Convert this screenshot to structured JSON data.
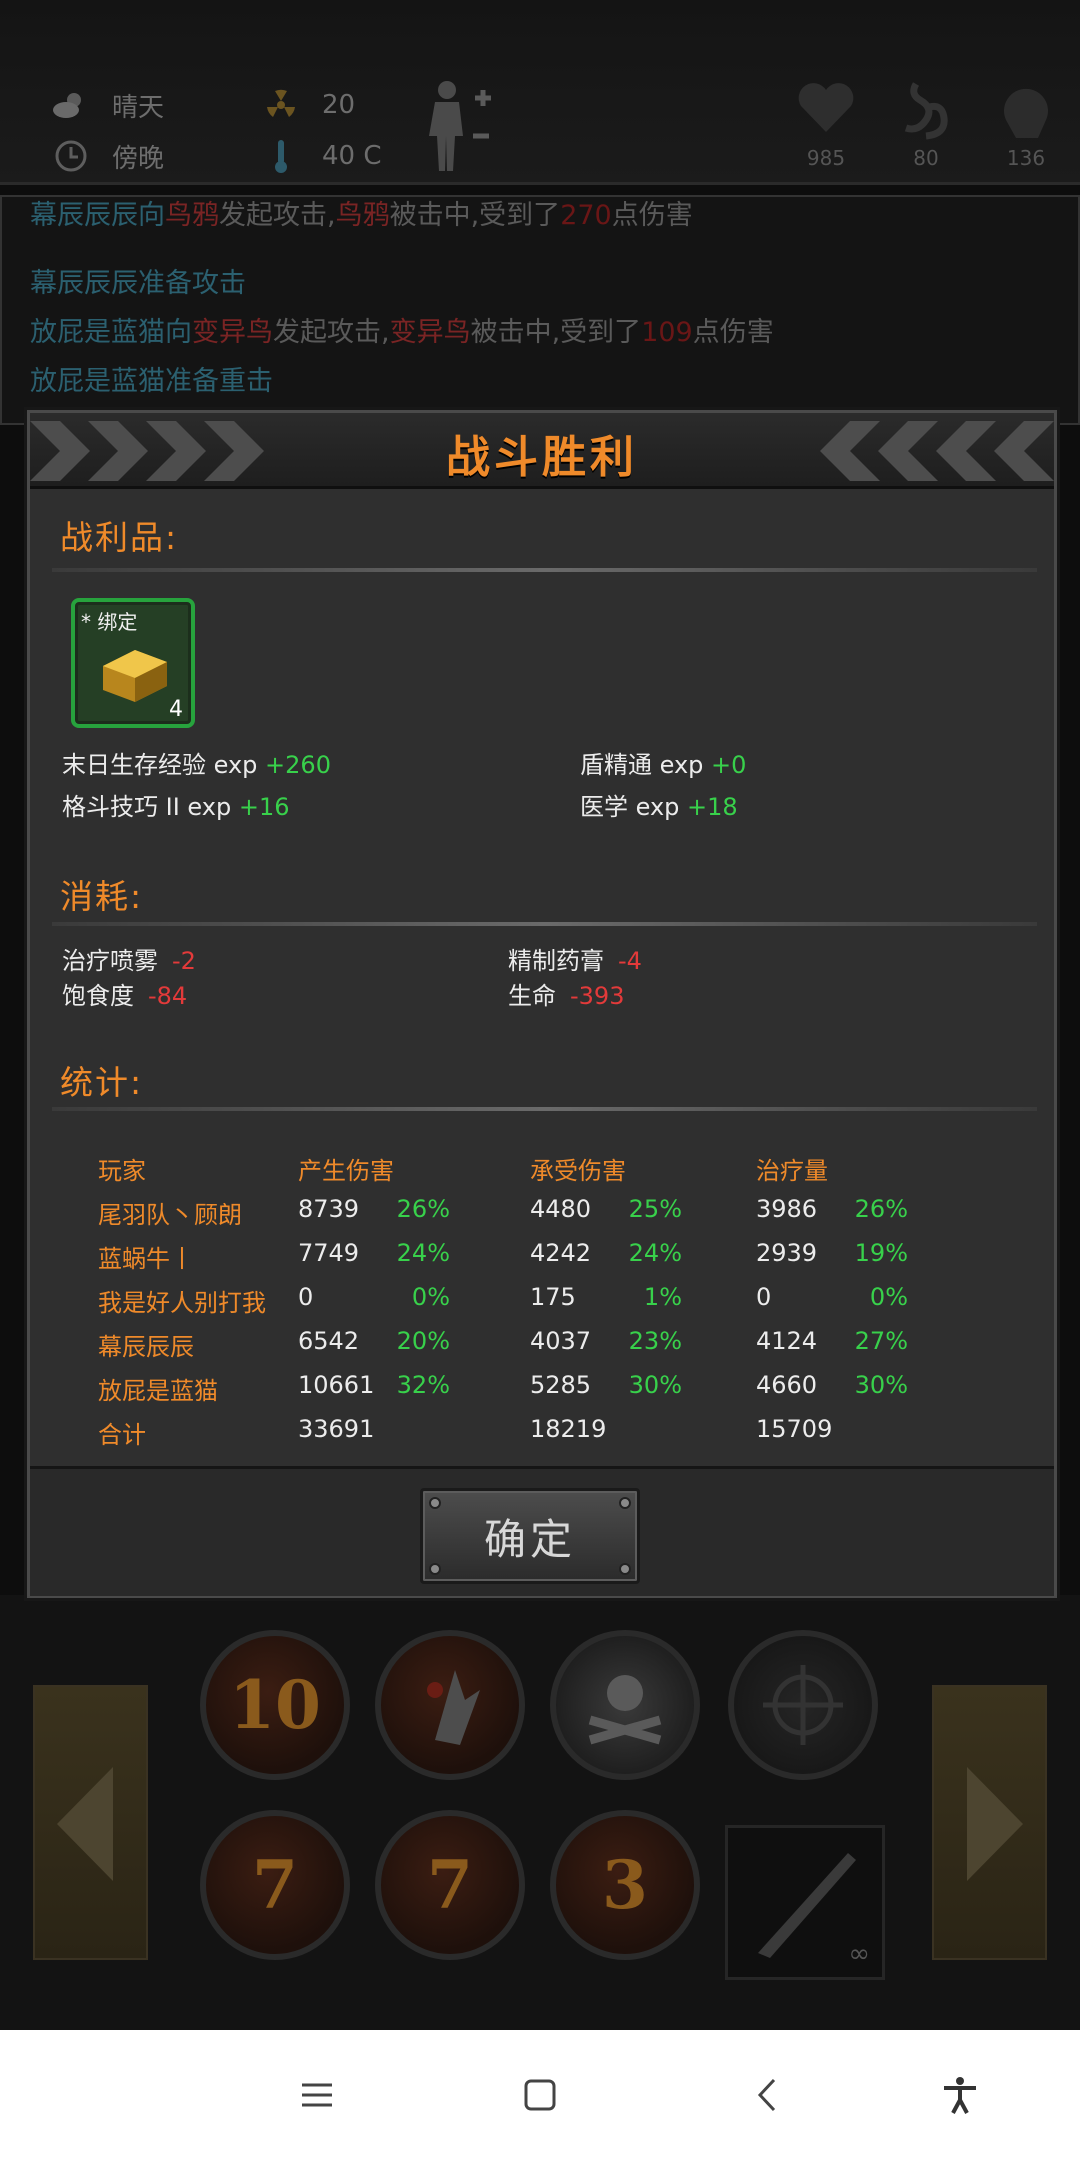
{
  "status": {
    "weather": "晴天",
    "time_of_day": "傍晚",
    "radiation": "20",
    "temperature": "40 C",
    "health": "985",
    "stomach": "80",
    "mood": "136"
  },
  "combat_log": {
    "line1_actor": "幕辰辰辰向",
    "line1_enemy": "鸟鸦",
    "line1_mid": "发起攻击,",
    "line1_enemy2": "鸟鸦",
    "line1_rest": "被击中,受到了",
    "line1_dmg": "270",
    "line1_end": "点伤害",
    "line2": "幕辰辰辰准备攻击",
    "line3_actor": "放屁是蓝猫向",
    "line3_enemy": "变异鸟",
    "line3_mid": "发起攻击,",
    "line3_enemy2": "变异鸟",
    "line3_rest": "被击中,受到了",
    "line3_dmg": "109",
    "line3_end": "点伤害",
    "line4": "放屁是蓝猫准备重击"
  },
  "dialog": {
    "title": "战斗胜利",
    "loot_title": "战利品:",
    "item": {
      "tag": "* 绑定",
      "count": "4",
      "icon": "gold-ingot-icon"
    },
    "exp": [
      {
        "label": "末日生存经验 exp ",
        "value": "+260"
      },
      {
        "label": "盾精通 exp ",
        "value": "+0"
      },
      {
        "label": "格斗技巧 II exp ",
        "value": "+16"
      },
      {
        "label": "医学 exp ",
        "value": "+18"
      }
    ],
    "consume_title": "消耗:",
    "consume": [
      {
        "label": "治疗喷雾",
        "value": "-2"
      },
      {
        "label": "精制药膏",
        "value": "-4"
      },
      {
        "label": "饱食度",
        "value": "-84"
      },
      {
        "label": "生命",
        "value": "-393"
      }
    ],
    "stats_title": "统计:",
    "stats_headers": [
      "玩家",
      "产生伤害",
      "承受伤害",
      "治疗量"
    ],
    "stats_rows": [
      {
        "name": "尾羽队丶顾朗",
        "dmg": "8739",
        "dmg_p": "26%",
        "taken": "4480",
        "taken_p": "25%",
        "heal": "3986",
        "heal_p": "26%"
      },
      {
        "name": "蓝蜗牛丨",
        "dmg": "7749",
        "dmg_p": "24%",
        "taken": "4242",
        "taken_p": "24%",
        "heal": "2939",
        "heal_p": "19%"
      },
      {
        "name": "我是好人别打我",
        "dmg": "0",
        "dmg_p": "0%",
        "taken": "175",
        "taken_p": "1%",
        "heal": "0",
        "heal_p": "0%"
      },
      {
        "name": "幕辰辰辰",
        "dmg": "6542",
        "dmg_p": "20%",
        "taken": "4037",
        "taken_p": "23%",
        "heal": "4124",
        "heal_p": "27%"
      },
      {
        "name": "放屁是蓝猫",
        "dmg": "10661",
        "dmg_p": "32%",
        "taken": "5285",
        "taken_p": "30%",
        "heal": "4660",
        "heal_p": "30%"
      }
    ],
    "total": {
      "name": "合计",
      "dmg": "33691",
      "taken": "18219",
      "heal": "15709"
    },
    "confirm_label": "确定"
  },
  "skills": {
    "skill1": "10",
    "skill5": "7",
    "skill6": "7",
    "skill7": "3",
    "weapon_count": "∞"
  },
  "colors": {
    "accent": "#ef8a2a",
    "positive": "#38d14b",
    "negative": "#e33a3a"
  }
}
